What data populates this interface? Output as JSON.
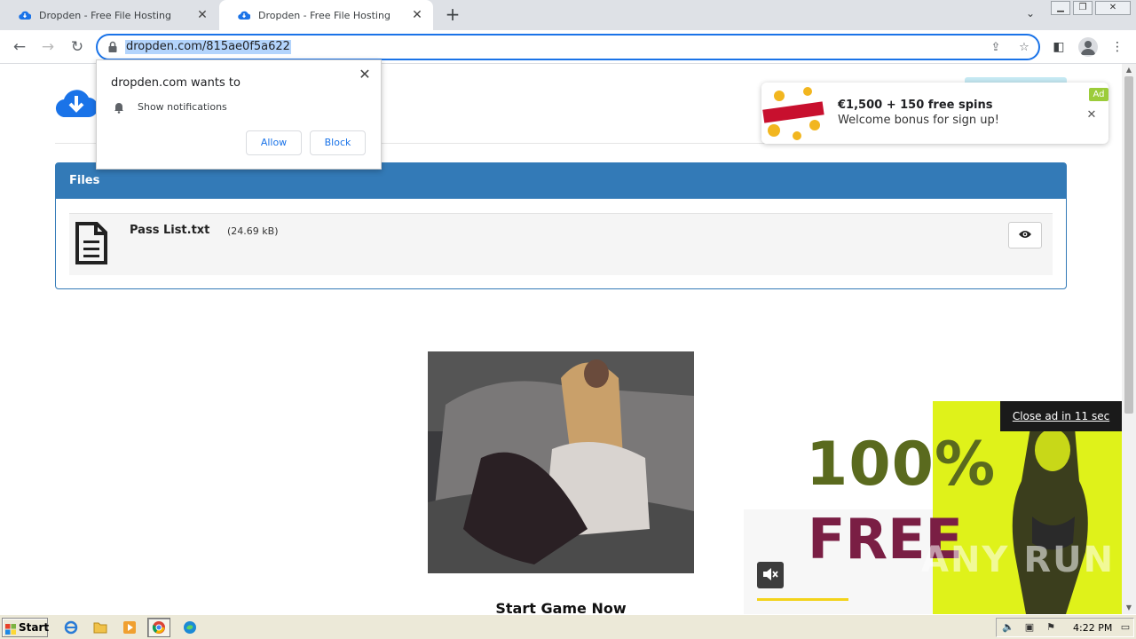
{
  "browser": {
    "tabs": [
      {
        "title": "Dropden - Free File Hosting",
        "active": false
      },
      {
        "title": "Dropden - Free File Hosting",
        "active": true
      }
    ],
    "url": "dropden.com/815ae0f5a622"
  },
  "notification_prompt": {
    "title": "dropden.com wants to",
    "permission": "Show notifications",
    "allow_label": "Allow",
    "block_label": "Block"
  },
  "top_ad": {
    "headline": "€1,500 + 150 free spins",
    "subtext": "Welcome bonus for sign up!",
    "tag": "Ad"
  },
  "files_panel": {
    "heading": "Files",
    "files": [
      {
        "name": "Pass List.txt",
        "size": "(24.69 kB)"
      }
    ]
  },
  "promo": {
    "cta": "Start Game Now"
  },
  "video_ad": {
    "line1": "100%",
    "line2": "FREE",
    "close_label": "Close ad in 11 sec",
    "watermark": "ANY RUN"
  },
  "taskbar": {
    "start_label": "Start",
    "clock": "4:22 PM"
  },
  "colors": {
    "primary_blue": "#337ab7",
    "chrome_blue": "#1a73e8",
    "ad_yellow": "#dff21a"
  }
}
